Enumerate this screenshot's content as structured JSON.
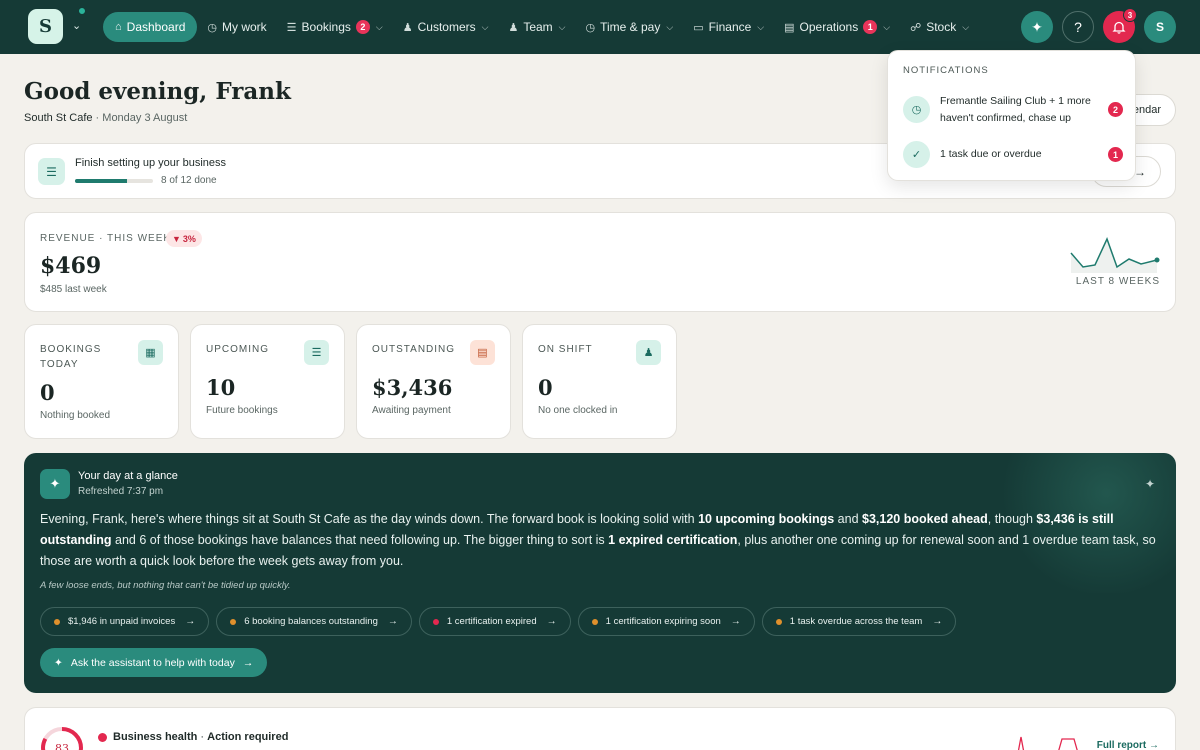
{
  "nav": {
    "logo_letter": "S",
    "items": [
      {
        "label": "Dashboard",
        "icon": "home-icon",
        "active": true
      },
      {
        "label": "My work",
        "icon": "clock-icon"
      },
      {
        "label": "Bookings",
        "icon": "list-icon",
        "badge": "2"
      },
      {
        "label": "Customers",
        "icon": "users-icon"
      },
      {
        "label": "Team",
        "icon": "team-icon"
      },
      {
        "label": "Time & pay",
        "icon": "clock-icon"
      },
      {
        "label": "Finance",
        "icon": "card-icon"
      },
      {
        "label": "Operations",
        "icon": "clipboard-icon",
        "badge": "1"
      },
      {
        "label": "Stock",
        "icon": "cart-icon"
      }
    ],
    "bell_badge": "3",
    "avatar": "S"
  },
  "header": {
    "greeting": "Good evening, Frank",
    "business": "South St Cafe",
    "date": "Monday 3 August",
    "calendar_label": "endar"
  },
  "setup": {
    "title": "Finish setting up your business",
    "progress_text": "8 of 12 done",
    "progress_fraction": 0.6667
  },
  "revenue": {
    "label": "REVENUE · THIS WEEK",
    "delta": "3%",
    "value": "$469",
    "last_week": "$485 last week",
    "sparkline_label": "LAST 8 WEEKS"
  },
  "stats": [
    {
      "label": "BOOKINGS TODAY",
      "value": "0",
      "sub": "Nothing booked",
      "icon": "calendar-icon"
    },
    {
      "label": "UPCOMING",
      "value": "10",
      "sub": "Future bookings",
      "icon": "list-icon"
    },
    {
      "label": "OUTSTANDING",
      "value": "$3,436",
      "sub": "Awaiting payment",
      "icon": "invoice-icon"
    },
    {
      "label": "ON SHIFT",
      "value": "0",
      "sub": "No one clocked in",
      "icon": "person-icon"
    }
  ],
  "glance": {
    "title": "Your day at a glance",
    "refreshed": "Refreshed 7:37 pm",
    "p1": "Evening, Frank, here's where things sit at South St Cafe as the day winds down. The forward book is looking solid with ",
    "b1": "10 upcoming bookings",
    "p2": " and ",
    "b2": "$3,120 booked ahead",
    "p3": ", though ",
    "b3": "$3,436 is still outstanding",
    "p4": " and 6 of those bookings have balances that need following up. The bigger thing to sort is ",
    "b4": "1 expired certification",
    "p5": ", plus another one coming up for renewal soon and 1 overdue team task, so those are worth a quick look before the week gets away from you.",
    "note": "A few loose ends, but nothing that can't be tidied up quickly.",
    "chips": [
      {
        "label": "$1,946 in unpaid invoices",
        "color": "#e0902c"
      },
      {
        "label": "6 booking balances outstanding",
        "color": "#e0902c"
      },
      {
        "label": "1 certification expired",
        "color": "#e3284f"
      },
      {
        "label": "1 certification expiring soon",
        "color": "#e0902c"
      },
      {
        "label": "1 task overdue across the team",
        "color": "#e0902c"
      }
    ],
    "ask_label": "Ask the assistant to help with today"
  },
  "health": {
    "score": "83",
    "title": "Business health",
    "status": "Action required",
    "full_report": "Full report"
  },
  "notifications": {
    "heading": "NOTIFICATIONS",
    "items": [
      {
        "text": "Fremantle Sailing Club + 1 more haven't confirmed, chase up",
        "badge": "2",
        "icon": "clock-icon"
      },
      {
        "text": "1 task due or overdue",
        "badge": "1",
        "icon": "check-icon"
      }
    ]
  },
  "colors": {
    "nav_bg": "#153a36",
    "accent": "#2a8b7d",
    "alert": "#e3284f",
    "warning": "#e0902c"
  }
}
